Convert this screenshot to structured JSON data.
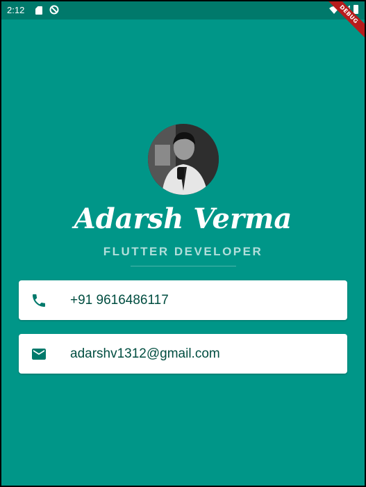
{
  "status_bar": {
    "time": "2:12",
    "debug_label": "DEBUG"
  },
  "profile": {
    "name": "Adarsh Verma",
    "role": "FLUTTER DEVELOPER"
  },
  "contacts": {
    "phone": "+91 9616486117",
    "email": "adarshv1312@gmail.com"
  },
  "colors": {
    "background": "#009688",
    "status_bar": "#00796b",
    "card_text": "#004d40",
    "role_text": "#b2dfdb"
  },
  "icons": {
    "phone": "phone-icon",
    "email": "mail-icon"
  }
}
